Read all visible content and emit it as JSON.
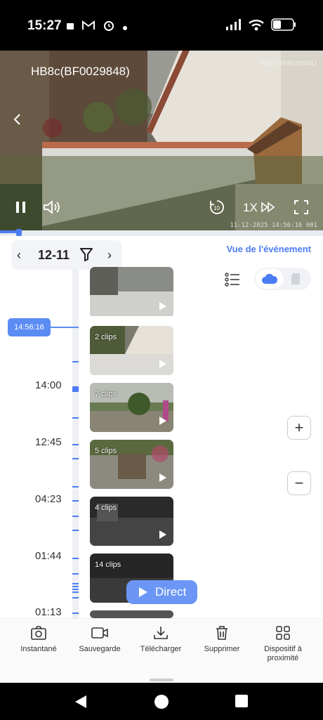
{
  "status_bar": {
    "time": "15:27"
  },
  "camera": {
    "title": "HB8c(BF0029848)",
    "overlay_id": "HB8c(BF0029848)",
    "overlay_timestamp": "11-12-2025 14:56:16 001",
    "speed": "1X",
    "progress_fraction": 0.05
  },
  "date_nav": {
    "date": "12-11"
  },
  "event_view_link": "Vue de l'événement",
  "timeline": {
    "current_time": "14:56:16",
    "labels": [
      "14:00",
      "12:45",
      "04:23",
      "01:44",
      "01:13"
    ]
  },
  "clips": [
    {
      "count_label": ""
    },
    {
      "count_label": "2 clips"
    },
    {
      "count_label": "7 clips"
    },
    {
      "count_label": "5 clips"
    },
    {
      "count_label": "4 clips"
    },
    {
      "count_label": "14 clips"
    },
    {
      "count_label": ""
    }
  ],
  "zoom": {
    "in": "+",
    "out": "−"
  },
  "direct_button": "Direct",
  "toolbar": {
    "snapshot": "Instantané",
    "record": "Sauvegarde",
    "download": "Télécharger",
    "delete": "Supprimer",
    "nearby_line1": "Dispositif à",
    "nearby_line2": "proximité"
  },
  "colors": {
    "accent": "#4b7cf3",
    "badge": "#5b8cf4"
  }
}
